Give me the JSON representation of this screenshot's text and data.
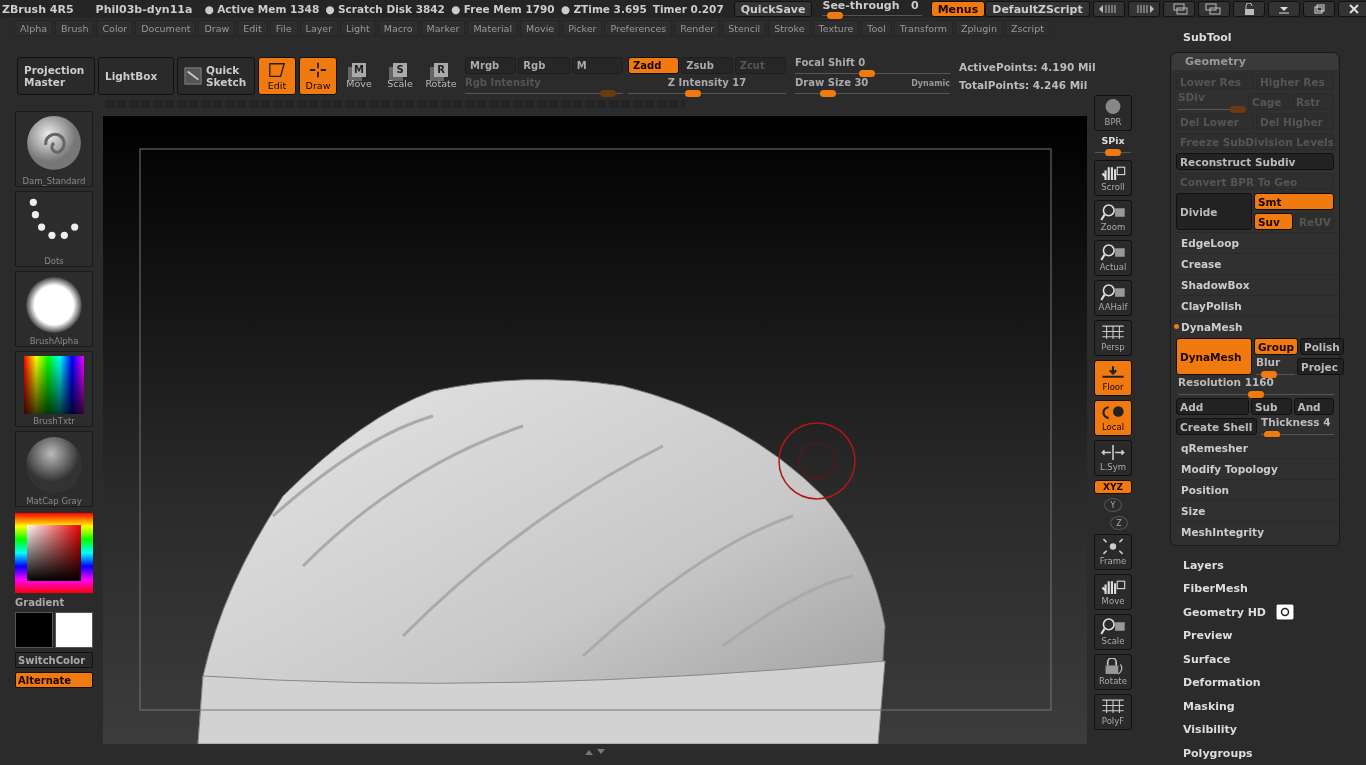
{
  "title_bar": {
    "app": "ZBrush 4R5",
    "document": "Phil03b-dyn11a",
    "stats": [
      {
        "label": "● Active Mem",
        "value": "1348"
      },
      {
        "label": "● Scratch Disk",
        "value": "3842"
      },
      {
        "label": "● Free Mem",
        "value": "1790"
      },
      {
        "label": "● ZTime",
        "value": "3.695"
      },
      {
        "label": "Timer",
        "value": "0.207"
      }
    ],
    "quicksave": "QuickSave",
    "see_through": {
      "label": "See-through",
      "value": "0",
      "level": 0.05
    },
    "menus": {
      "label": "Menus",
      "on": true
    },
    "script": "DefaultZScript"
  },
  "menu_bar": [
    "Alpha",
    "Brush",
    "Color",
    "Document",
    "Draw",
    "Edit",
    "File",
    "Layer",
    "Light",
    "Macro",
    "Marker",
    "Material",
    "Movie",
    "Picker",
    "Preferences",
    "Render",
    "Stencil",
    "Stroke",
    "Texture",
    "Tool",
    "Transform",
    "Zplugin",
    "Zscript"
  ],
  "toolbar": {
    "projection_master": "Projection Master",
    "lightbox": "LightBox",
    "quick_sketch": "Quick Sketch",
    "modes": [
      {
        "label": "Edit",
        "on": true
      },
      {
        "label": "Draw",
        "on": true
      },
      {
        "label": "Move",
        "key": "M",
        "on": false
      },
      {
        "label": "Scale",
        "key": "S",
        "on": false
      },
      {
        "label": "Rotate",
        "key": "R",
        "on": false
      }
    ],
    "channels": [
      {
        "label": "Mrgb",
        "on": false
      },
      {
        "label": "Rgb",
        "on": false
      },
      {
        "label": "M",
        "on": false
      }
    ],
    "rgb_intensity": {
      "label": "Rgb Intensity",
      "level": 0.95,
      "disabled": true
    },
    "z_modes": [
      {
        "label": "Zadd",
        "on": true,
        "disabled": false
      },
      {
        "label": "Zsub",
        "on": false,
        "disabled": false
      },
      {
        "label": "Zcut",
        "on": false,
        "disabled": true
      }
    ],
    "z_intensity": {
      "label": "Z Intensity",
      "value": "17",
      "level": 0.4,
      "disabled": false
    },
    "focal_shift": {
      "label": "Focal Shift",
      "value": "0",
      "level": 0.46,
      "disabled": false
    },
    "draw_size": {
      "label": "Draw Size",
      "value": "30",
      "level": 0.18,
      "disabled": false
    },
    "dynamic": "Dynamic",
    "points": [
      {
        "label": "ActivePoints:",
        "value": "4.190 Mil"
      },
      {
        "label": "TotalPoints:",
        "value": "4.246 Mil"
      }
    ]
  },
  "left_shelf": {
    "thumbnails": [
      {
        "kind": "brush",
        "label": "Dam_Standard"
      },
      {
        "kind": "stroke",
        "label": "Dots"
      },
      {
        "kind": "alpha",
        "label": "BrushAlpha"
      },
      {
        "kind": "texture",
        "label": "BrushTxtr"
      },
      {
        "kind": "material",
        "label": "MatCap Gray"
      }
    ],
    "gradient": "Gradient",
    "swatches": [
      {
        "color": "#000000"
      },
      {
        "color": "#ffffff"
      }
    ],
    "switch_color": "SwitchColor",
    "alternate": {
      "label": "Alternate",
      "on": true
    }
  },
  "right_shelf": [
    {
      "kind": "button",
      "label": "BPR",
      "on": false
    },
    {
      "kind": "slider",
      "label": "SPix",
      "level": 0.5
    },
    {
      "kind": "button",
      "label": "Scroll",
      "on": false
    },
    {
      "kind": "button",
      "label": "Zoom",
      "on": false
    },
    {
      "kind": "button",
      "label": "Actual",
      "on": false
    },
    {
      "kind": "button",
      "label": "AAHalf",
      "on": false
    },
    {
      "kind": "button",
      "label": "Persp",
      "on": false
    },
    {
      "kind": "button",
      "label": "Floor",
      "on": true
    },
    {
      "kind": "button",
      "label": "Local",
      "on": true
    },
    {
      "kind": "button",
      "label": "L.Sym",
      "on": false
    },
    {
      "kind": "toggle",
      "label": "XYZ",
      "on": true
    },
    {
      "kind": "axis",
      "label": "Y"
    },
    {
      "kind": "axis",
      "label": "Z"
    },
    {
      "kind": "button",
      "label": "Frame",
      "on": false
    },
    {
      "kind": "button",
      "label": "Move",
      "on": false
    },
    {
      "kind": "button",
      "label": "Scale",
      "on": false
    },
    {
      "kind": "button",
      "label": "Rotate",
      "on": false
    },
    {
      "kind": "button",
      "label": "PolyF",
      "on": false
    }
  ],
  "palette": [
    {
      "label": "SubTool",
      "expanded": false,
      "kind": "plain"
    },
    {
      "label": "Geometry",
      "expanded": true,
      "kind": "plain",
      "rows": [
        {
          "kind": "row",
          "items": [
            {
              "kind": "button",
              "label": "Lower Res",
              "on": false,
              "disabled": true
            },
            {
              "kind": "button",
              "label": "Higher Res",
              "on": false,
              "disabled": true
            }
          ]
        },
        {
          "kind": "row",
          "items": [
            {
              "kind": "slider",
              "label": "SDiv",
              "level": 1,
              "disabled": true
            },
            {
              "kind": "button",
              "label": "Cage",
              "on": false,
              "disabled": true
            },
            {
              "kind": "button",
              "label": "Rstr",
              "on": false,
              "disabled": true
            }
          ]
        },
        {
          "kind": "row",
          "items": [
            {
              "kind": "button",
              "label": "Del Lower",
              "on": false,
              "disabled": true
            },
            {
              "kind": "button",
              "label": "Del Higher",
              "on": false,
              "disabled": true
            }
          ]
        },
        {
          "kind": "row",
          "items": [
            {
              "kind": "button",
              "label": "Freeze SubDivision Levels",
              "on": false,
              "disabled": true
            }
          ]
        },
        {
          "kind": "row",
          "items": [
            {
              "kind": "button",
              "label": "Reconstruct Subdiv",
              "on": false,
              "disabled": false
            }
          ]
        },
        {
          "kind": "row",
          "items": [
            {
              "kind": "button",
              "label": "Convert BPR To Geo",
              "on": false,
              "disabled": true
            }
          ]
        },
        {
          "kind": "block",
          "main": {
            "label": "Divide",
            "on": false
          },
          "rows": [
            [
              {
                "kind": "button",
                "label": "Smt",
                "on": true,
                "disabled": false
              }
            ],
            [
              {
                "kind": "button",
                "label": "Suv",
                "on": true,
                "disabled": false
              },
              {
                "kind": "button",
                "label": "ReUV",
                "on": false,
                "disabled": true
              }
            ]
          ]
        }
      ],
      "sections": [
        {
          "label": "EdgeLoop",
          "expanded": false
        },
        {
          "label": "Crease",
          "expanded": false
        },
        {
          "label": "ShadowBox",
          "expanded": false
        },
        {
          "label": "ClayPolish",
          "expanded": false
        },
        {
          "label": "DynaMesh",
          "expanded": true,
          "rows": [
            {
              "kind": "block",
              "main": {
                "label": "DynaMesh",
                "on": true
              },
              "rows": [
                [
                  {
                    "kind": "button",
                    "label": "Group",
                    "on": true,
                    "disabled": false
                  },
                  {
                    "kind": "button",
                    "label": "Polish",
                    "on": false,
                    "disabled": false
                  }
                ],
                [
                  {
                    "kind": "slider",
                    "label": "Blur",
                    "level": 0.2,
                    "disabled": false
                  },
                  {
                    "kind": "button",
                    "label": "Projec",
                    "on": false,
                    "disabled": false
                  }
                ]
              ]
            },
            {
              "kind": "row",
              "items": [
                {
                  "kind": "slider",
                  "label": "Resolution",
                  "value": "1160",
                  "level": 0.5,
                  "disabled": false
                }
              ]
            },
            {
              "kind": "row",
              "items": [
                {
                  "kind": "button",
                  "label": "Add",
                  "on": false,
                  "disabled": false
                },
                {
                  "kind": "button",
                  "label": "Sub",
                  "on": false,
                  "disabled": false
                },
                {
                  "kind": "button",
                  "label": "And",
                  "on": false,
                  "disabled": false
                }
              ]
            },
            {
              "kind": "row",
              "items": [
                {
                  "kind": "button",
                  "label": "Create Shell",
                  "on": false,
                  "disabled": false
                },
                {
                  "kind": "slider",
                  "label": "Thickness",
                  "value": "4",
                  "level": 0.05,
                  "disabled": false
                }
              ]
            }
          ]
        },
        {
          "label": "qRemesher",
          "expanded": false
        },
        {
          "label": "Modify Topology",
          "expanded": false
        },
        {
          "label": "Position",
          "expanded": false
        },
        {
          "label": "Size",
          "expanded": false
        },
        {
          "label": "MeshIntegrity",
          "expanded": false
        }
      ]
    },
    {
      "label": "Layers",
      "expanded": false,
      "kind": "plain"
    },
    {
      "label": "FiberMesh",
      "expanded": false,
      "kind": "plain"
    },
    {
      "label": "Geometry HD",
      "expanded": false,
      "kind": "icon"
    },
    {
      "label": "Preview",
      "expanded": false,
      "kind": "plain"
    },
    {
      "label": "Surface",
      "expanded": false,
      "kind": "plain"
    },
    {
      "label": "Deformation",
      "expanded": false,
      "kind": "plain"
    },
    {
      "label": "Masking",
      "expanded": false,
      "kind": "plain"
    },
    {
      "label": "Visibility",
      "expanded": false,
      "kind": "plain"
    },
    {
      "label": "Polygroups",
      "expanded": false,
      "kind": "plain"
    }
  ]
}
